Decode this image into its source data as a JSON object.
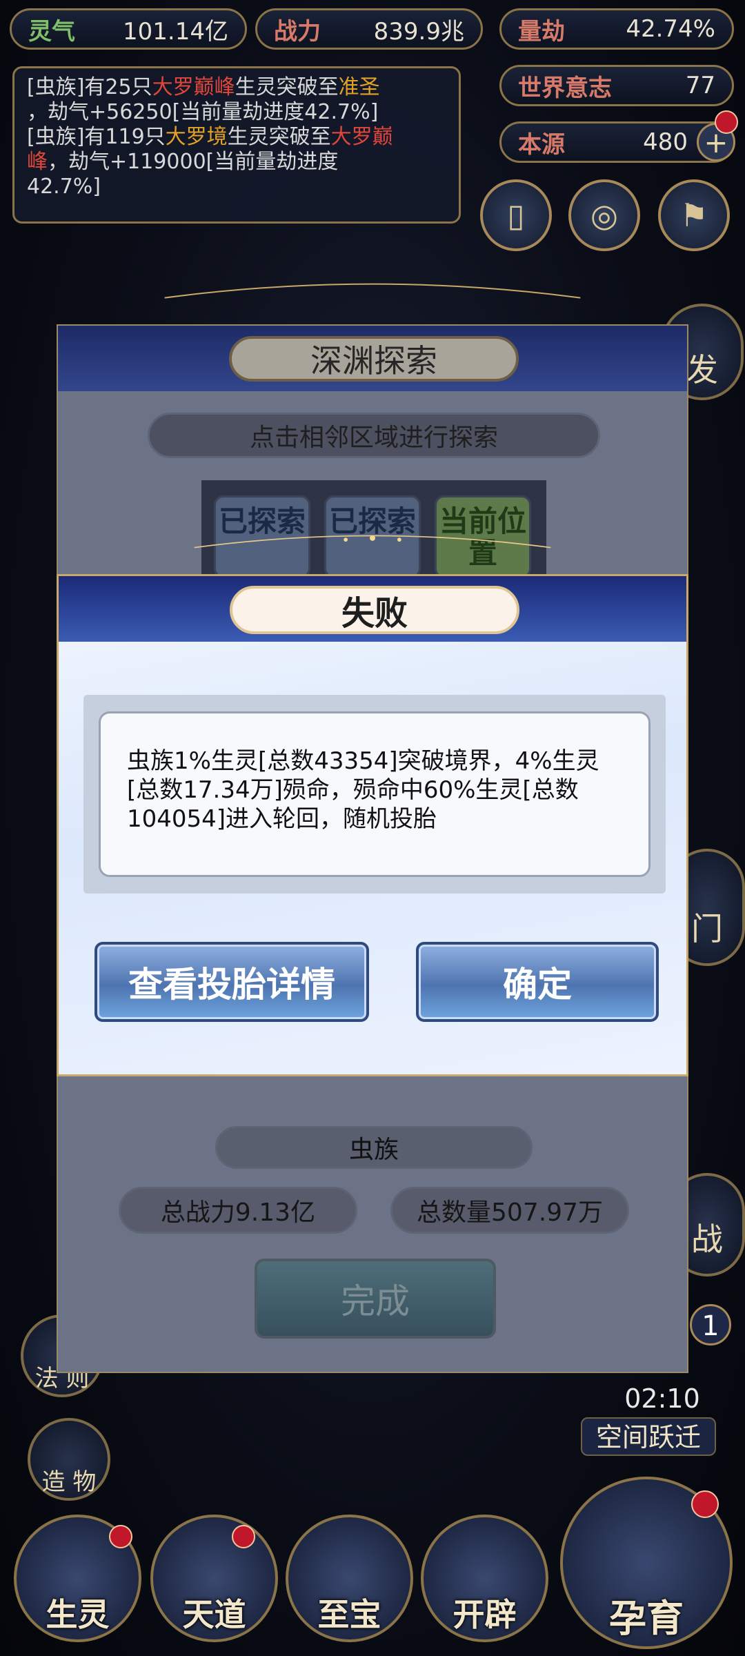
{
  "stats": {
    "lingqi": {
      "label": "灵气",
      "value": "101.14亿"
    },
    "zhanli": {
      "label": "战力",
      "value": "839.9兆"
    },
    "liangjie": {
      "label": "量劫",
      "value": "42.74%"
    },
    "shijie": {
      "label": "世界意志",
      "value": "77"
    },
    "benyuan": {
      "label": "本源",
      "value": "480"
    }
  },
  "log": {
    "l1_a": "[虫族]有25只",
    "l1_b": "大罗巅峰",
    "l1_c": "生灵突破至",
    "l1_d": "准圣",
    "l1_e": "，劫气+56250[当前量劫进度42.7%]",
    "l2_a": "[虫族]有119只",
    "l2_b": "大罗境",
    "l2_c": "生灵突破至",
    "l2_d": "大罗巅",
    "l2_e": "峰",
    "l2_f": "，劫气+119000[当前量劫进度",
    "l2_g": "42.7%]"
  },
  "right_partial": {
    "jifa": "发",
    "men": "门",
    "zhan": "战",
    "num": "1",
    "timer": "02:10",
    "jump": "空间跃迁"
  },
  "left_menu": {
    "fa": "法 则",
    "zao": "造 物"
  },
  "bottom_nav": [
    "生灵",
    "天道",
    "至宝",
    "开辟"
  ],
  "yunyu": "孕育",
  "explore": {
    "title": "深渊探索",
    "hint": "点击相邻区域进行探索",
    "cells": [
      "已探索",
      "已探索",
      "当前位置"
    ],
    "race": "虫族",
    "total_power": "总战力9.13亿",
    "total_count": "总数量507.97万",
    "done": "完成"
  },
  "dialog": {
    "title": "失败",
    "message": "虫族1%生灵[总数43354]突破境界，4%生灵[总数17.34万]殒命，殒命中60%生灵[总数104054]进入轮回，随机投胎",
    "detail_button": "查看投胎详情",
    "confirm_button": "确定"
  }
}
